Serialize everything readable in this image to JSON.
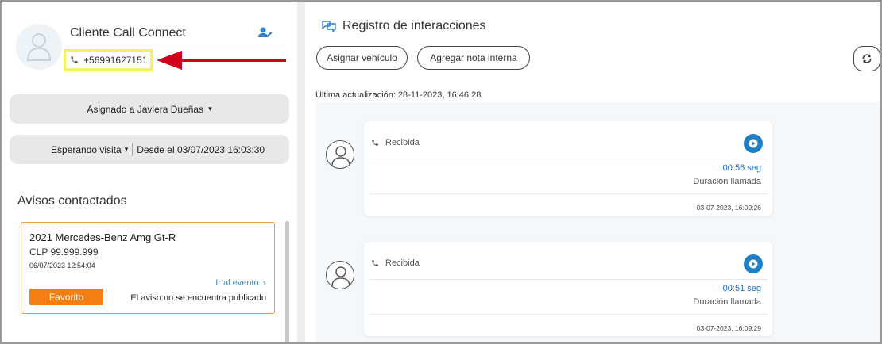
{
  "contact": {
    "name": "Cliente Call Connect",
    "phone": "+56991627151"
  },
  "assignment": {
    "label": "Asignado a Javiera Dueñas",
    "caret": "▾"
  },
  "visit": {
    "status": "Esperando visita",
    "caret": "▾",
    "since": "Desde el 03/07/2023 16:03:30"
  },
  "avisos": {
    "title": "Avisos contactados",
    "items": [
      {
        "title": "2021 Mercedes-Benz Amg Gt-R",
        "price": "CLP 99.999.999",
        "date": "06/07/2023 12:54:04",
        "link": "Ir al evento",
        "link_chevron": "›",
        "favorite": "Favorito",
        "status": "El aviso no se encuentra publicado"
      }
    ]
  },
  "registro": {
    "title": "Registro de interacciones",
    "buttons": {
      "asignar": "Asignar vehículo",
      "nota": "Agregar nota interna"
    },
    "last_update": "Última actualización: 28-11-2023, 16:46:28",
    "calls": [
      {
        "type": "Recibida",
        "duration": "00:56 seg",
        "duration_label": "Duración llamada",
        "timestamp": "03-07-2023, 16:09:26"
      },
      {
        "type": "Recibida",
        "duration": "00:51 seg",
        "duration_label": "Duración llamada",
        "timestamp": "03-07-2023, 16:09:29"
      }
    ]
  },
  "colors": {
    "accent_blue": "#1f7fc4",
    "link_blue": "#3a86c8",
    "favorite_orange": "#f47e11",
    "annotation_red": "#d0021b",
    "highlight_yellow": "#f3f06b"
  },
  "icons": {
    "contact_avatar": "user-avatar-icon",
    "assign": "user-edit-icon",
    "phone": "phone-icon",
    "chat": "chat-bubbles-icon",
    "refresh": "refresh-icon",
    "play": "play-icon"
  }
}
